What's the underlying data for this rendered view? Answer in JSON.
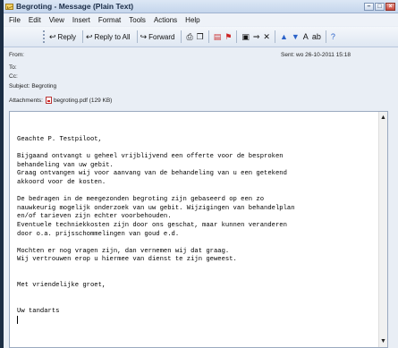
{
  "window": {
    "title": "Begroting - Message (Plain Text)"
  },
  "menu": [
    "File",
    "Edit",
    "View",
    "Insert",
    "Format",
    "Tools",
    "Actions",
    "Help"
  ],
  "toolbar": {
    "reply": "Reply",
    "reply_all": "Reply to All",
    "forward": "Forward"
  },
  "header": {
    "from_label": "From:",
    "to_label": "To:",
    "cc_label": "Cc:",
    "subject_label": "Subject:",
    "subject": "Begroting",
    "sent_label": "Sent:",
    "sent_value": "wo 26-10-2011 15:18",
    "attachments_label": "Attachments:",
    "attachment": "begroting.pdf (129 KB)"
  },
  "body": {
    "lines": [
      "Geachte P. Testpiloot,",
      "",
      "Bijgaand ontvangt u geheel vrijblijvend een offerte voor de besproken",
      "behandeling van uw gebit.",
      "Graag ontvangen wij voor aanvang van de behandeling van u een getekend",
      "akkoord voor de kosten.",
      "",
      "De bedragen in de meegezonden begroting zijn gebaseerd op een zo",
      "nauwkeurig mogelijk onderzoek van uw gebit. Wijzigingen van behandelplan",
      "en/of tarieven zijn echter voorbehouden.",
      "Eventuele techniekkosten zijn door ons geschat, maar kunnen veranderen",
      "door o.a. prijsschommelingen van goud e.d.",
      "",
      "Mochten er nog vragen zijn, dan vernemen wij dat graag.",
      "Wij vertrouwen erop u hiermee van dienst te zijn geweest.",
      "",
      "",
      "Met vriendelijke groet,",
      "",
      "",
      "Uw tandarts"
    ]
  }
}
